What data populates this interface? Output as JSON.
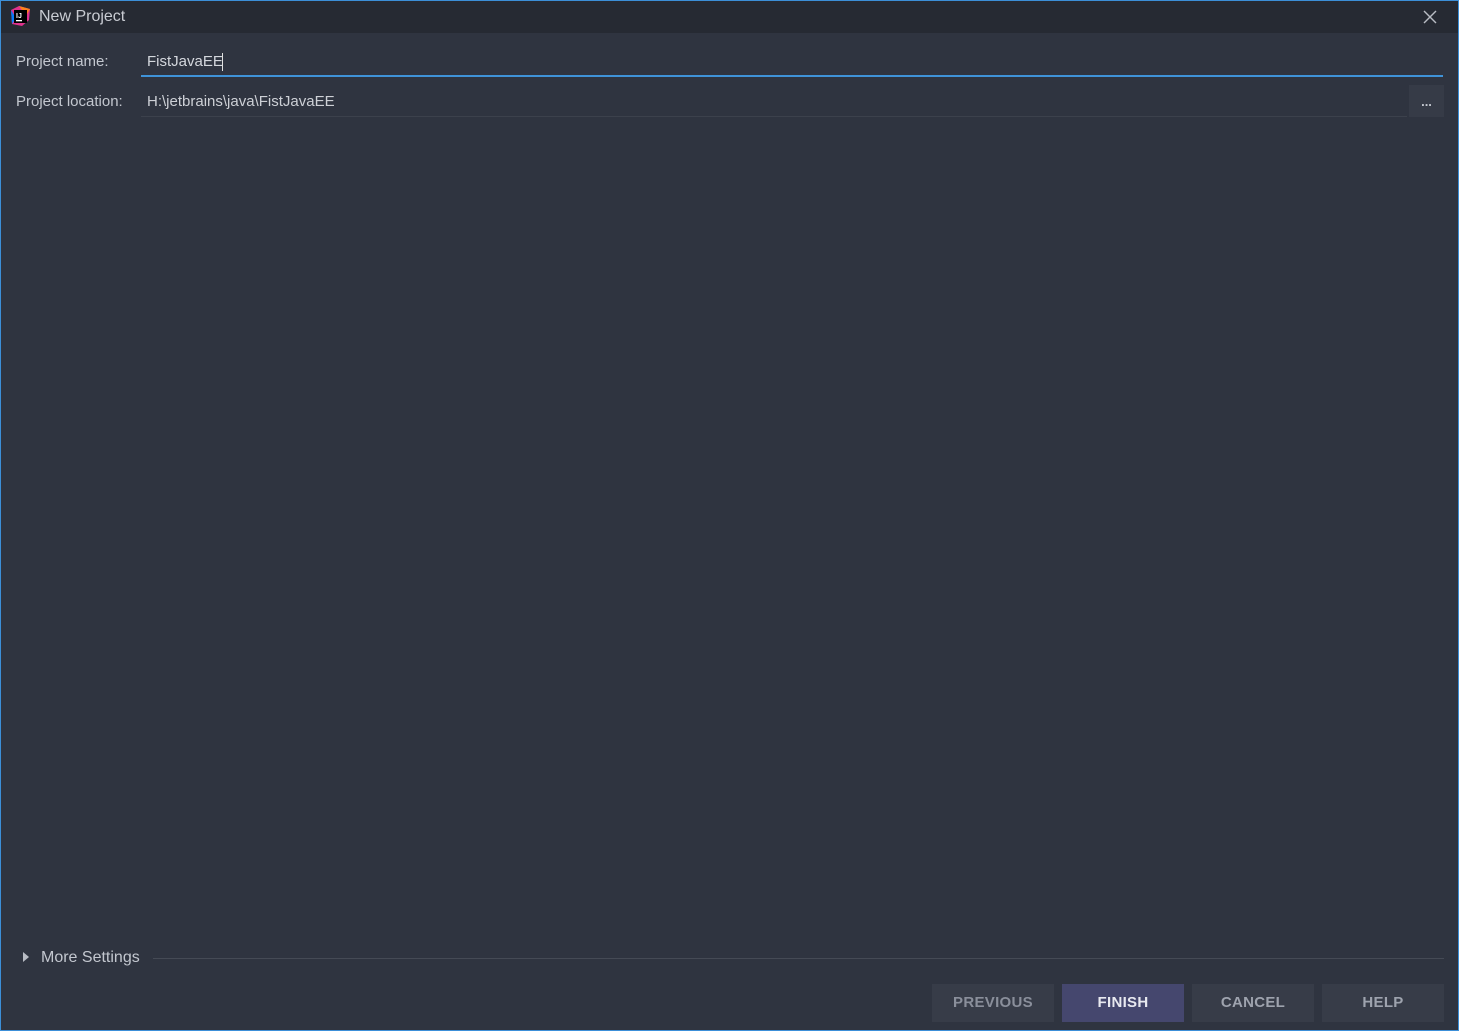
{
  "window": {
    "title": "New Project"
  },
  "form": {
    "name_label": "Project name:",
    "name_value": "FistJavaEE",
    "location_label": "Project location:",
    "location_value": "H:\\jetbrains\\java\\FistJavaEE",
    "browse_label": "..."
  },
  "more_settings": {
    "label": "More Settings",
    "expanded": false
  },
  "buttons": {
    "previous": "PREVIOUS",
    "finish": "FINISH",
    "cancel": "CANCEL",
    "help": "HELP"
  },
  "icons": {
    "app": "intellij-idea-icon",
    "close": "close-icon",
    "expand": "triangle-right-icon"
  },
  "colors": {
    "background": "#2f3440",
    "titlebar": "#262a33",
    "focus_accent": "#3f93d9",
    "primary_button": "#45476e",
    "secondary_button": "#373c48"
  }
}
